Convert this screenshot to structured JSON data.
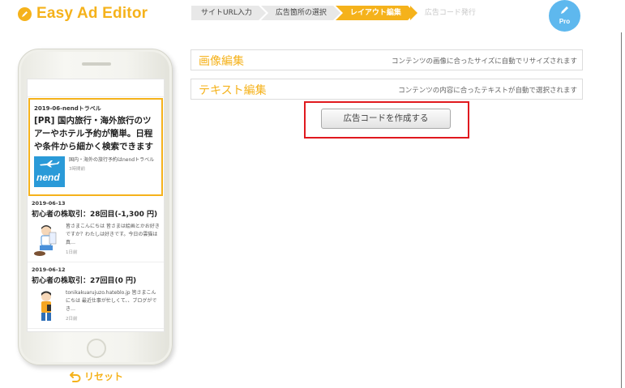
{
  "app": {
    "title": "Easy Ad Editor"
  },
  "steps": [
    {
      "label": "サイトURL入力",
      "state": "done"
    },
    {
      "label": "広告箇所の選択",
      "state": "done"
    },
    {
      "label": "レイアウト編集",
      "state": "active"
    },
    {
      "label": "広告コード発行",
      "state": "disabled"
    }
  ],
  "pro": {
    "label": "Pro",
    "icon": "pencil-icon"
  },
  "preview": {
    "ad": {
      "source": "2019-06-nendトラベル",
      "title": "[PR] 国内旅行・海外旅行のツアーやホテル予約が簡単。日程や条件から細かく検索できます",
      "logo_text": "nend",
      "description": "国内・海外の旅行予約はnendトラベル",
      "time": "3時間前"
    },
    "articles": [
      {
        "date": "2019-06-13",
        "title": "初心者の株取引：28回目(-1,300 円)",
        "description": "皆さまこんにちは 皆さまは絵画とかお好きですか？わたしは好きです。今日の雲猫は真…",
        "time": "1日前"
      },
      {
        "date": "2019-06-12",
        "title": "初心者の株取引：27回目(0 円)",
        "description": "tonikakuarujuzo.hateblo.jp 皆さまこんにちは 最近仕事が忙しくて、、ブログができ…",
        "time": "2日前"
      }
    ]
  },
  "reset": {
    "label": "リセット",
    "icon": "undo-icon"
  },
  "panels": [
    {
      "title": "画像編集",
      "description": "コンテンツの画像に合ったサイズに自動でリサイズされます"
    },
    {
      "title": "テキスト編集",
      "description": "コンテンツの内容に合ったテキストが自動で選択されます"
    }
  ],
  "generate_button": {
    "label": "広告コードを作成する"
  },
  "colors": {
    "accent": "#f5b21b",
    "pro": "#5eb8ee",
    "highlight": "#e0191e"
  }
}
